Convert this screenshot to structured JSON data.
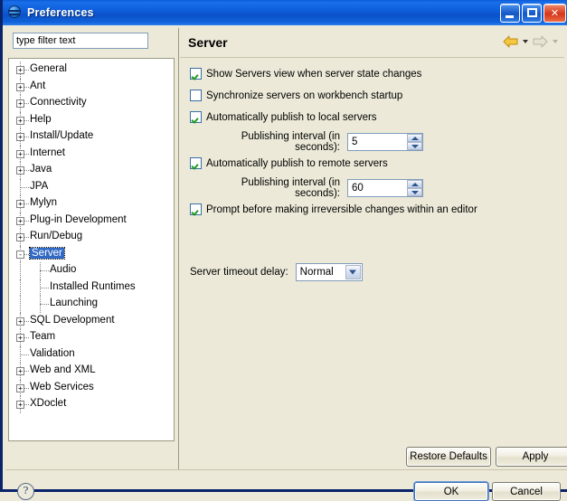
{
  "window": {
    "title": "Preferences",
    "icon": "globe-icon",
    "buttons": {
      "minimize": "Minimize",
      "maximize": "Maximize",
      "close": "Close"
    }
  },
  "sidebar": {
    "filter": {
      "value": "type filter text",
      "placeholder": "type filter text"
    },
    "items": [
      {
        "label": "General",
        "indent": 0,
        "expander": "+"
      },
      {
        "label": "Ant",
        "indent": 0,
        "expander": "+"
      },
      {
        "label": "Connectivity",
        "indent": 0,
        "expander": "+"
      },
      {
        "label": "Help",
        "indent": 0,
        "expander": "+"
      },
      {
        "label": "Install/Update",
        "indent": 0,
        "expander": "+"
      },
      {
        "label": "Internet",
        "indent": 0,
        "expander": "+"
      },
      {
        "label": "Java",
        "indent": 0,
        "expander": "+"
      },
      {
        "label": "JPA",
        "indent": 0,
        "expander": ""
      },
      {
        "label": "Mylyn",
        "indent": 0,
        "expander": "+"
      },
      {
        "label": "Plug-in Development",
        "indent": 0,
        "expander": "+"
      },
      {
        "label": "Run/Debug",
        "indent": 0,
        "expander": "+"
      },
      {
        "label": "Server",
        "indent": 0,
        "expander": "-",
        "selected": true
      },
      {
        "label": "Audio",
        "indent": 1,
        "expander": ""
      },
      {
        "label": "Installed Runtimes",
        "indent": 1,
        "expander": ""
      },
      {
        "label": "Launching",
        "indent": 1,
        "expander": ""
      },
      {
        "label": "SQL Development",
        "indent": 0,
        "expander": "+"
      },
      {
        "label": "Team",
        "indent": 0,
        "expander": "+"
      },
      {
        "label": "Validation",
        "indent": 0,
        "expander": ""
      },
      {
        "label": "Web and XML",
        "indent": 0,
        "expander": "+"
      },
      {
        "label": "Web Services",
        "indent": 0,
        "expander": "+"
      },
      {
        "label": "XDoclet",
        "indent": 0,
        "expander": "+"
      }
    ]
  },
  "page": {
    "title": "Server",
    "nav": {
      "back_icon": "back-arrow-icon",
      "back_menu_icon": "chevron-down-icon",
      "forward_icon": "forward-arrow-icon",
      "forward_menu_icon": "chevron-down-icon"
    },
    "checkboxes": [
      {
        "label": "Show Servers view when server state changes",
        "checked": true
      },
      {
        "label": "Synchronize servers on workbench startup",
        "checked": false
      },
      {
        "label": "Automatically publish to local servers",
        "checked": true
      },
      {
        "label": "Automatically publish to remote servers",
        "checked": true
      },
      {
        "label": "Prompt before making irreversible changes within an editor",
        "checked": true
      }
    ],
    "local_interval": {
      "label": "Publishing interval (in seconds):",
      "value": "5"
    },
    "remote_interval": {
      "label": "Publishing interval (in seconds):",
      "value": "60"
    },
    "timeout": {
      "label": "Server timeout delay:",
      "value": "Normal",
      "options": [
        "Normal"
      ]
    },
    "restore_defaults_label": "Restore Defaults",
    "apply_label": "Apply"
  },
  "footer": {
    "help_icon": "help-question-icon",
    "ok_label": "OK",
    "cancel_label": "Cancel"
  },
  "colors": {
    "titlebar_blue": "#0f5fdc",
    "dialog_bg": "#ece9d8",
    "selection_blue": "#316ac5",
    "check_green": "#1f9c22",
    "back_arrow_gold": "#e8a317"
  }
}
